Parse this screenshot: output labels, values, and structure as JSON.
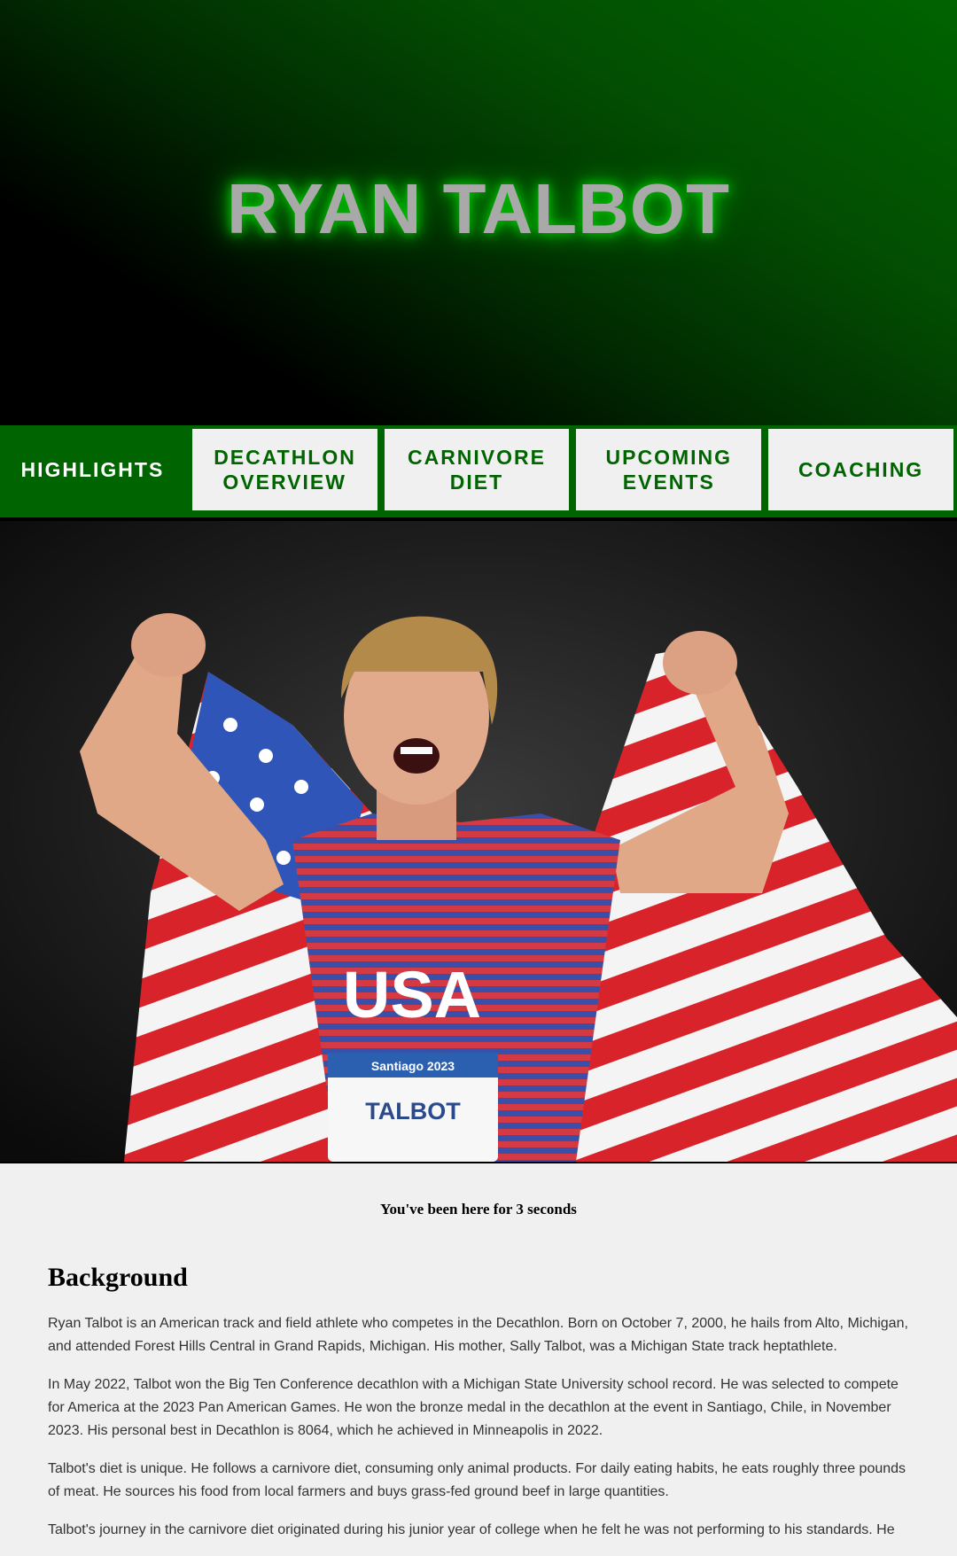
{
  "header": {
    "title": "RYAN TALBOT"
  },
  "nav": {
    "items": [
      {
        "label": "HIGHLIGHTS",
        "active": true
      },
      {
        "label": "DECATHLON OVERVIEW",
        "active": false
      },
      {
        "label": "CARNIVORE DIET",
        "active": false
      },
      {
        "label": "UPCOMING EVENTS",
        "active": false
      },
      {
        "label": "COACHING",
        "active": false
      }
    ]
  },
  "hero_photo": {
    "description_icon": "athlete-with-flag-photo",
    "jersey_text": "USA",
    "bib_event": "Santiago 2023",
    "bib_name": "TALBOT"
  },
  "timer": {
    "text": "You've been here for 3 seconds"
  },
  "main": {
    "heading": "Background",
    "paragraphs": [
      "Ryan Talbot is an American track and field athlete who competes in the Decathlon. Born on October 7, 2000, he hails from Alto, Michigan, and attended Forest Hills Central in Grand Rapids, Michigan. His mother, Sally Talbot, was a Michigan State track heptathlete.",
      "In May 2022, Talbot won the Big Ten Conference decathlon with a Michigan State University school record. He was selected to compete for America at the 2023 Pan American Games. He won the bronze medal in the decathlon at the event in Santiago, Chile, in November 2023. His personal best in Decathlon is 8064, which he achieved in Minneapolis in 2022.",
      "Talbot's diet is unique. He follows a carnivore diet, consuming only animal products. For daily eating habits, he eats roughly three pounds of meat. He sources his food from local farmers and buys grass-fed ground beef in large quantities.",
      "Talbot's journey in the carnivore diet originated during his junior year of college when he felt he was not performing to his standards. He"
    ]
  },
  "colors": {
    "brand_green": "#006400",
    "title_gray": "#a9a9a9",
    "page_bg": "#f0f0f0"
  }
}
